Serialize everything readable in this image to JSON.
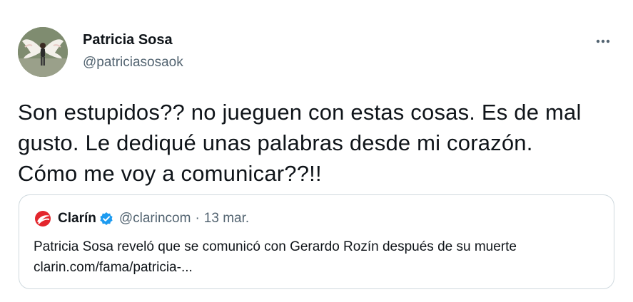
{
  "author": {
    "display_name": "Patricia Sosa",
    "handle": "@patriciasosaok",
    "avatar_icon": "profile-photo-angel-wings"
  },
  "more_icon": "more-horizontal-icon",
  "tweet": {
    "lines": [
      "Son estupidos?? no jueguen con estas cosas. Es de mal",
      "gusto. Le dediqué unas palabras desde mi corazón.",
      "Cómo me voy a comunicar??!!"
    ]
  },
  "quoted": {
    "logo_icon": "clarin-logo",
    "display_name": "Clarín",
    "verified_icon": "verified-badge-icon",
    "handle": "@clarincom",
    "separator": "·",
    "time": "13 mar.",
    "lines": [
      "Patricia Sosa reveló que se comunicó con Gerardo Rozín después de su muerte",
      "clarin.com/fama/patricia-..."
    ]
  },
  "colors": {
    "text": "#0f1419",
    "secondary": "#536471",
    "border": "#cfd9de",
    "verified": "#1d9bf0",
    "clarin_red": "#e3262d"
  }
}
